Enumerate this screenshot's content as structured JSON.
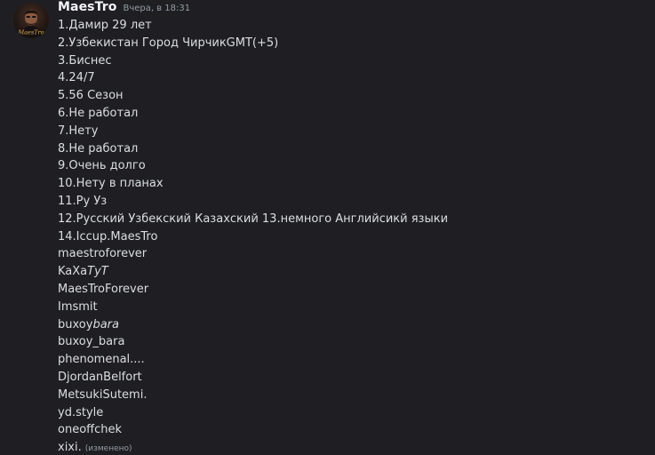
{
  "message": {
    "username": "MaesTro",
    "timestamp": "Вчера, в 18:31",
    "avatar_icon": "user-avatar-icon",
    "avatar_text": "MaesTro",
    "colors": {
      "background": "#1f1f23",
      "text": "#dbdee1",
      "username": "#f2f3f5",
      "muted": "#949ba4"
    },
    "lines": [
      "1.Дамир 29 лет",
      "2.Узбекистан Город ЧирчикGMT(+5)",
      "3.Биснес",
      "4.24/7",
      "5.56 Сезон",
      "6.Не работал",
      "7.Нету",
      "8.Не работал",
      "9.Очень долго",
      "10.Нету в планах",
      "11.Ру Уз",
      "12.Русский Узбекский Казахский 13.немного Английсикй языки",
      "14.Iccup.MaesTro",
      "maestroforever",
      "KaXa",
      "ТуТ",
      "MaesTroForever",
      "Imsmit",
      "buxoy",
      "bara",
      "buxoy_bara",
      "phenomenal....",
      "DjordanBelfort",
      "MetsukiSutemi.",
      "yd.style",
      "oneoffchek",
      "xixi."
    ],
    "edited_label": "(изменено)"
  }
}
